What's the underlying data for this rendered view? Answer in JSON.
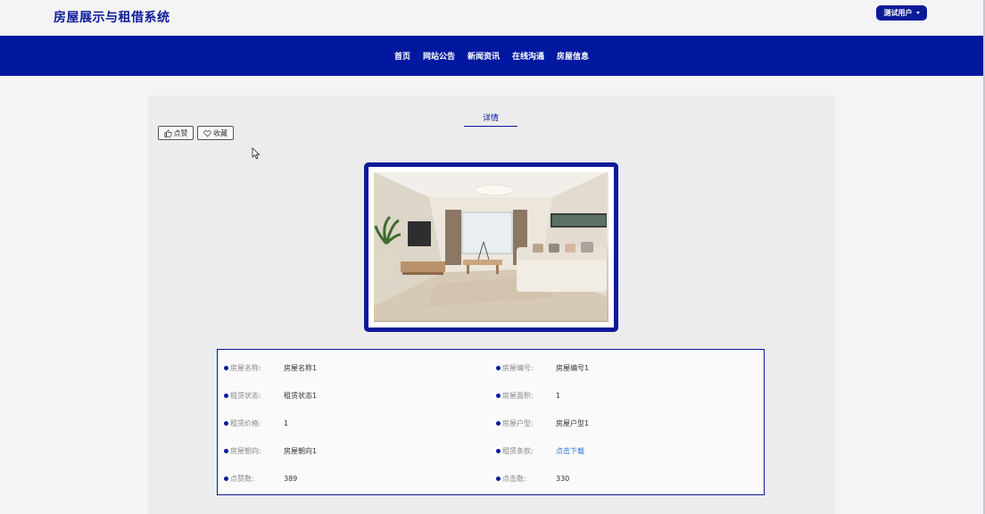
{
  "site": {
    "title": "房屋展示与租借系统",
    "user_button": "测试用户"
  },
  "nav": {
    "items": [
      "首页",
      "网站公告",
      "新闻资讯",
      "在线沟通",
      "房屋信息"
    ]
  },
  "detail": {
    "tab_label": "详情",
    "like_label": "点赞",
    "favorite_label": "收藏",
    "colors": {
      "primary": "#0c1a99",
      "nav_bg": "#0018a0",
      "link": "#2874d6"
    },
    "rows": [
      {
        "l_label": "房屋名称:",
        "l_value": "房屋名称1",
        "r_label": "房屋编号:",
        "r_value": "房屋编号1"
      },
      {
        "l_label": "租赁状态:",
        "l_value": "租赁状态1",
        "r_label": "房屋面积:",
        "r_value": "1"
      },
      {
        "l_label": "租赁价格:",
        "l_value": "1",
        "r_label": "房屋户型:",
        "r_value": "房屋户型1"
      },
      {
        "l_label": "房屋朝向:",
        "l_value": "房屋朝向1",
        "r_label": "租赁条款:",
        "r_value": "点击下载"
      },
      {
        "l_label": "点赞数:",
        "l_value": "389",
        "r_label": "点击数:",
        "r_value": "330"
      }
    ]
  }
}
